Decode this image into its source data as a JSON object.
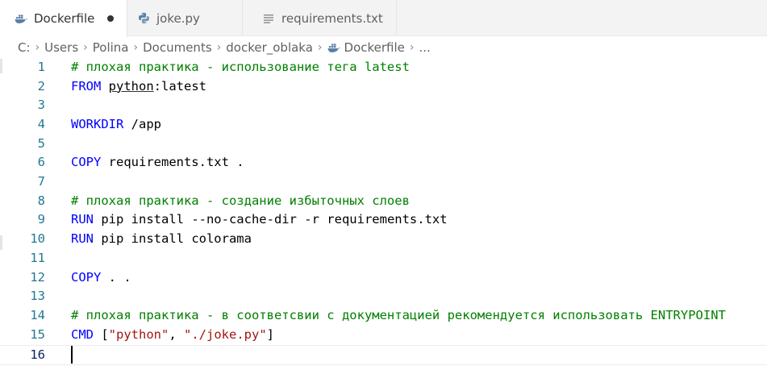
{
  "tabs": [
    {
      "label": "Dockerfile",
      "icon": "docker-icon",
      "active": true,
      "modified": true
    },
    {
      "label": "joke.py",
      "icon": "python-icon",
      "active": false
    },
    {
      "label": "requirements.txt",
      "icon": "text-file-icon",
      "active": false
    }
  ],
  "breadcrumb": {
    "items": [
      "C:",
      "Users",
      "Polina",
      "Documents",
      "docker_oblaka",
      "Dockerfile",
      "..."
    ]
  },
  "editor": {
    "line_numbers": [
      "1",
      "2",
      "3",
      "4",
      "5",
      "6",
      "7",
      "8",
      "9",
      "10",
      "11",
      "12",
      "13",
      "14",
      "15",
      "16"
    ],
    "lines": {
      "l1_comment": "# плохая практика - использование тега latest",
      "l2_kw": "FROM",
      "l2_image": "python",
      "l2_rest": ":latest",
      "l4_kw": "WORKDIR",
      "l4_rest": " /app",
      "l6_kw": "COPY",
      "l6_rest": " requirements.txt .",
      "l8_comment": "# плохая практика - создание избыточных слоев",
      "l9_kw": "RUN",
      "l9_rest": " pip install --no-cache-dir -r requirements.txt",
      "l10_kw": "RUN",
      "l10_rest": " pip install colorama",
      "l12_kw": "COPY",
      "l12_rest": " . .",
      "l14_comment": "# плохая практика - в соответсвии с документацией рекомендуется использовать ENTRYPOINT",
      "l15_kw": "CMD",
      "l15_open": " [",
      "l15_str1": "\"python\"",
      "l15_comma": ", ",
      "l15_str2": "\"./joke.py\"",
      "l15_close": "]"
    },
    "current_line": 16
  },
  "colors": {
    "comment": "#008000",
    "keyword": "#0000ff",
    "string": "#a31515",
    "line_number": "#237893",
    "docker_blue": "#2496ed",
    "python_blue": "#3572a5"
  }
}
